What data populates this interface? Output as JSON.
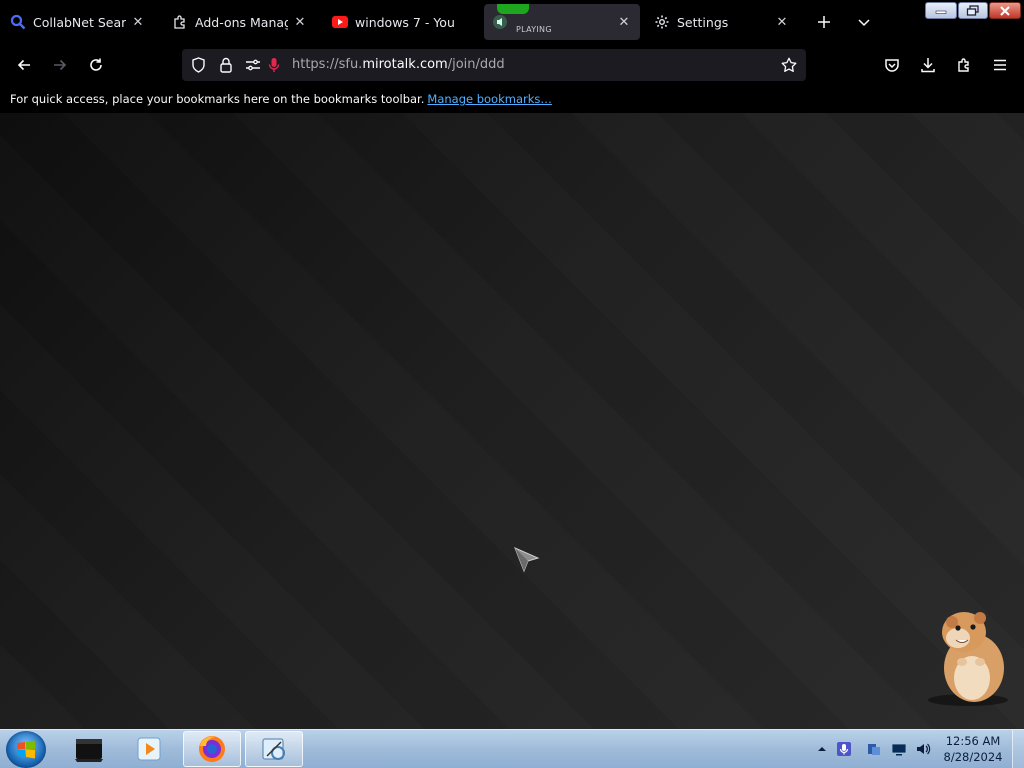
{
  "tabs": [
    {
      "title": "CollabNet SearXNG",
      "icon": "search-icon"
    },
    {
      "title": "Add-ons Manager",
      "icon": "puzzle-icon"
    },
    {
      "title": "windows 7 - You",
      "icon": "youtube-icon"
    },
    {
      "title": "PLAYING",
      "icon": "speaker-icon"
    },
    {
      "title": "Settings",
      "icon": "gear-icon"
    }
  ],
  "navbar": {
    "url_prefix": "https://sfu.",
    "url_domain": "mirotalk.com",
    "url_path": "/join/ddd"
  },
  "bookmarks_bar": {
    "message": "For quick access, place your bookmarks here on the bookmarks toolbar.",
    "link": "Manage bookmarks…"
  },
  "taskbar": {
    "time": "12:56 AM",
    "date": "8/28/2024",
    "apps": [
      "terminal-icon",
      "media-player-icon",
      "firefox-icon",
      "snipping-tool-icon"
    ]
  },
  "colors": {
    "toolbar": "#000000",
    "urlbar": "#1c1b22",
    "link": "#50b0ff",
    "taskbar": "#9fbbd9"
  }
}
